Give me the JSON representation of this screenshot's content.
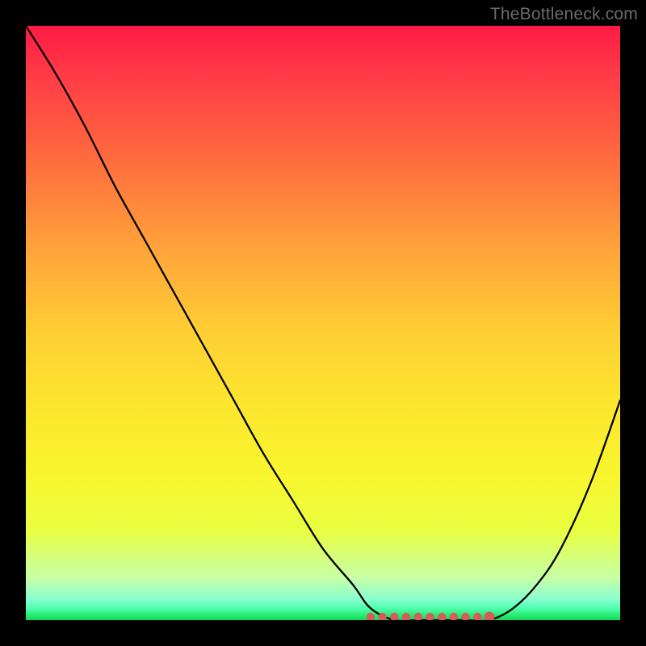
{
  "watermark": "TheBottleneck.com",
  "chart_data": {
    "type": "line",
    "title": "",
    "xlabel": "",
    "ylabel": "",
    "xlim": [
      0,
      100
    ],
    "ylim": [
      0,
      100
    ],
    "series": [
      {
        "name": "bottleneck-curve",
        "x": [
          0,
          5,
          10,
          15,
          20,
          25,
          30,
          35,
          40,
          45,
          50,
          55,
          58,
          62,
          66,
          70,
          74,
          78,
          82,
          86,
          90,
          95,
          100
        ],
        "y": [
          100,
          92,
          83,
          73,
          64,
          55,
          46,
          37,
          28,
          20,
          12,
          6,
          2,
          0,
          0,
          0,
          0,
          0,
          2,
          6,
          12,
          23,
          37
        ]
      }
    ],
    "valley_markers": {
      "name": "valley-dots",
      "x": [
        58,
        60,
        62,
        64,
        66,
        68,
        70,
        72,
        74,
        76,
        78
      ],
      "color": "#d95a5a",
      "end_radius_larger": true
    },
    "gradient_stops": [
      {
        "pos": 0,
        "color": "#ff1a45"
      },
      {
        "pos": 50,
        "color": "#ffd034"
      },
      {
        "pos": 85,
        "color": "#f8f62e"
      },
      {
        "pos": 100,
        "color": "#10d858"
      }
    ]
  }
}
